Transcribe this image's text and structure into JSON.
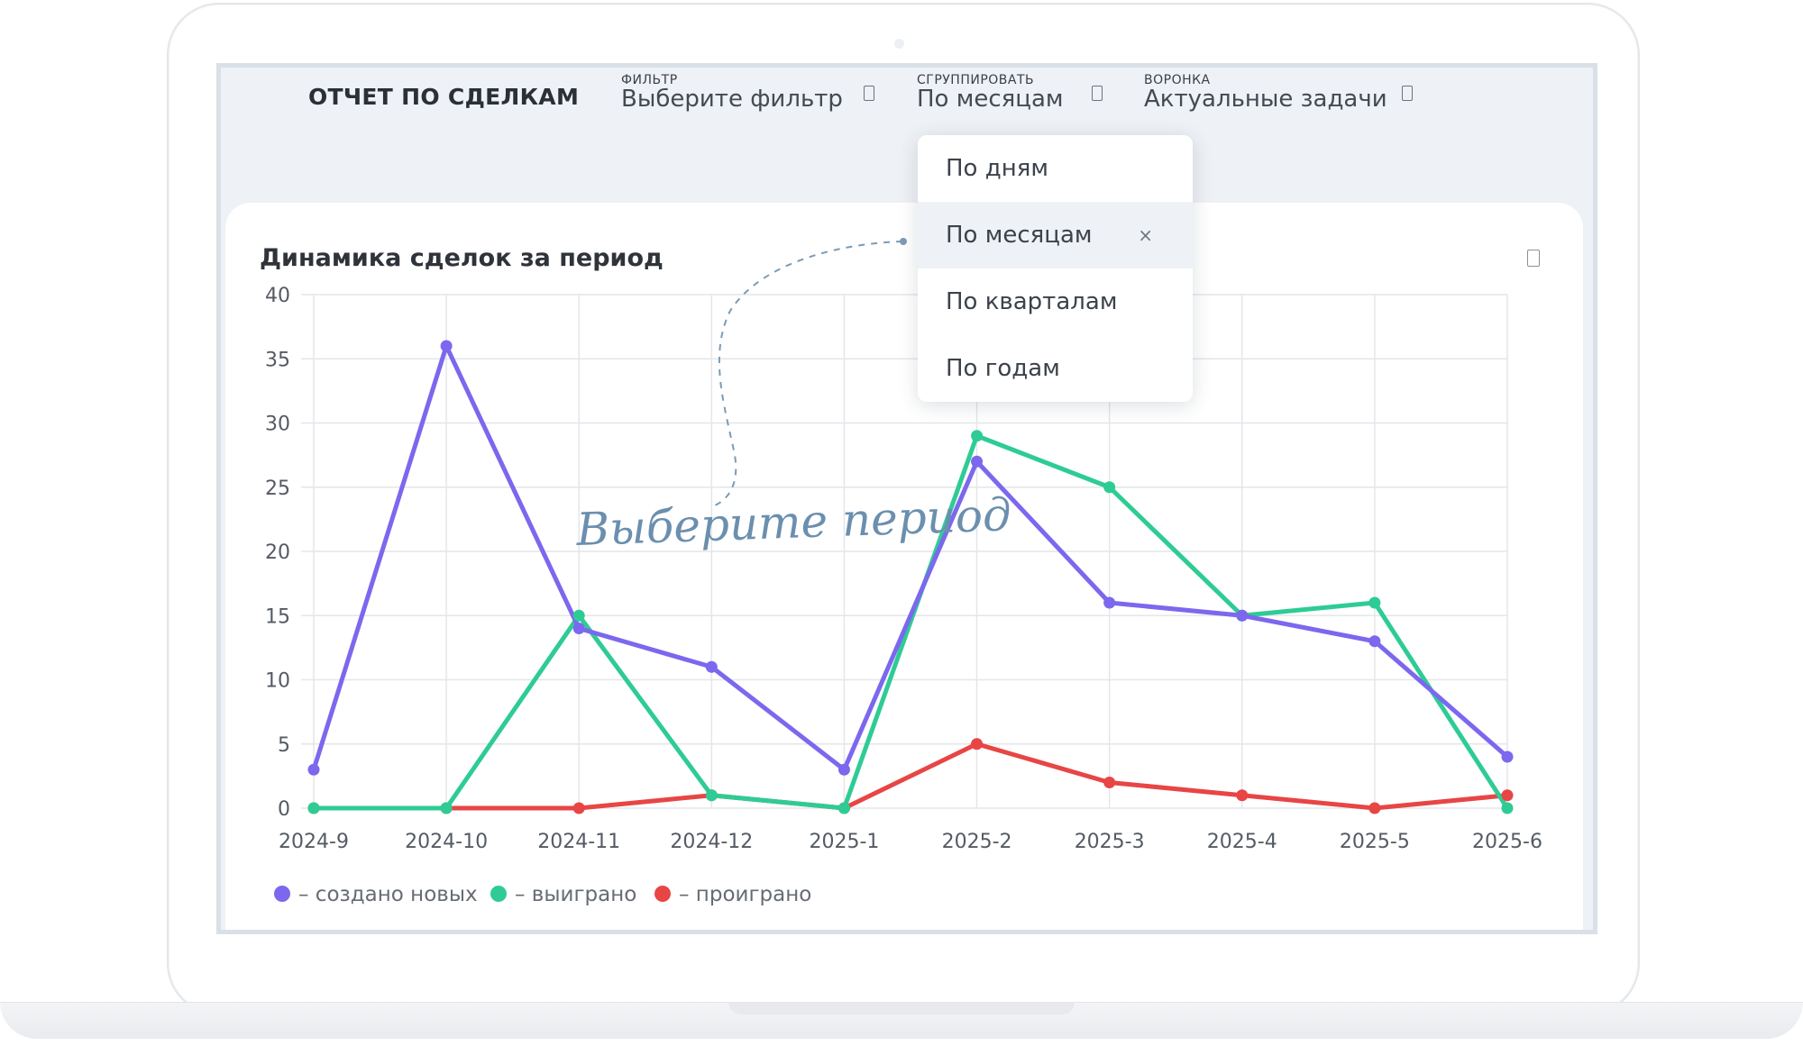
{
  "toolbar": {
    "report_title": "ОТЧЕТ ПО СДЕЛКАМ",
    "filter": {
      "label": "ФИЛЬТР",
      "value": "Выберите фильтр"
    },
    "group": {
      "label": "СГРУППИРОВАТЬ",
      "value": "По месяцам"
    },
    "funnel": {
      "label": "ВОРОНКА",
      "value": "Актуальные задачи"
    }
  },
  "dropdown": {
    "items": [
      "По дням",
      "По месяцам",
      "По кварталам",
      "По годам"
    ],
    "selected_index": 1,
    "clear_symbol": "×"
  },
  "annotation": {
    "text": "Выберите период",
    "color": "#6b8fae"
  },
  "chart_data": {
    "type": "line",
    "title": "Динамика сделок за период",
    "categories": [
      "2024-9",
      "2024-10",
      "2024-11",
      "2024-12",
      "2025-1",
      "2025-2",
      "2025-3",
      "2025-4",
      "2025-5",
      "2025-6"
    ],
    "ylim": [
      0,
      40
    ],
    "yticks": [
      0,
      5,
      10,
      15,
      20,
      25,
      30,
      35,
      40
    ],
    "grid": true,
    "legend_position": "bottom-left",
    "series": [
      {
        "name": "– создано новых",
        "color": "#7b68ee",
        "values": [
          3,
          36,
          14,
          11,
          3,
          27,
          16,
          15,
          13,
          4
        ]
      },
      {
        "name": "– выиграно",
        "color": "#2ecc94",
        "values": [
          0,
          0,
          15,
          1,
          0,
          29,
          25,
          15,
          16,
          0
        ]
      },
      {
        "name": "– проиграно",
        "color": "#e84545",
        "values": [
          0,
          0,
          0,
          1,
          0,
          5,
          2,
          1,
          0,
          1
        ]
      }
    ]
  }
}
